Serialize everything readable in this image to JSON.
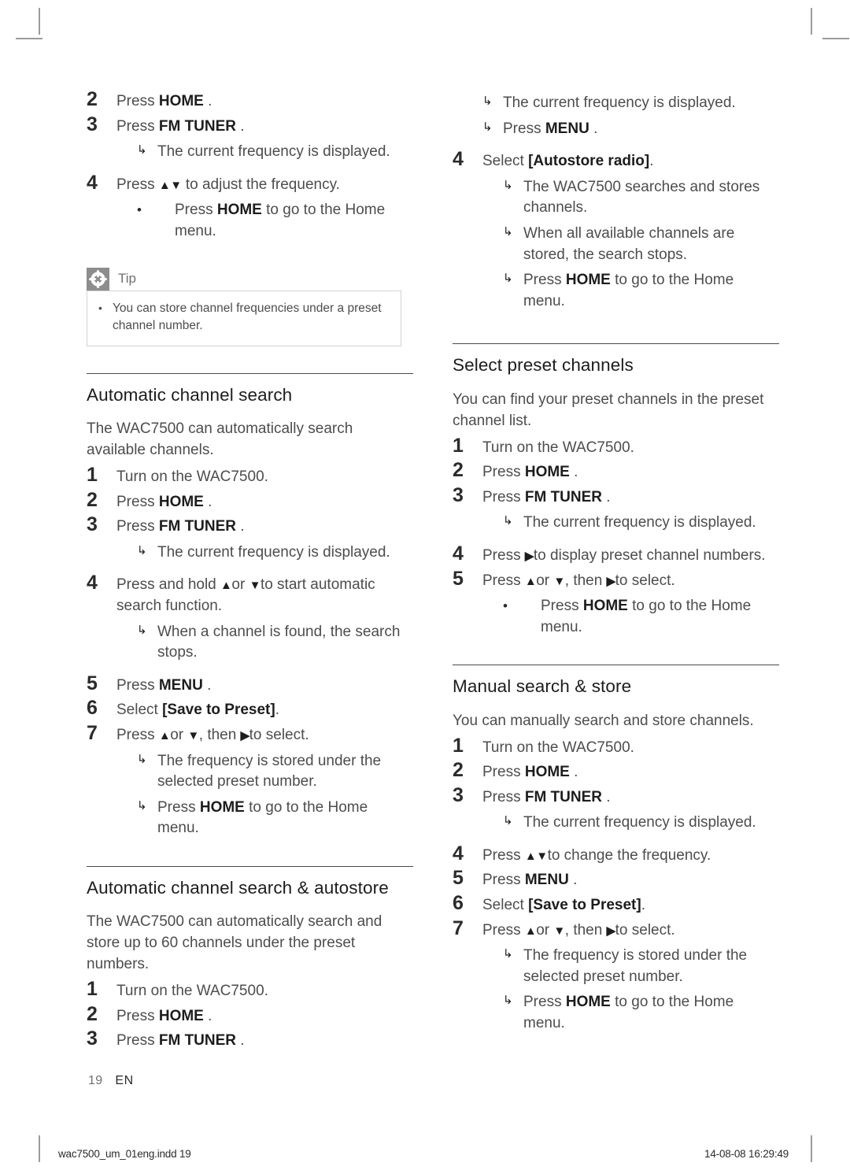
{
  "document": {
    "page_number": "19",
    "language_code": "EN",
    "print_footer_file": "wac7500_um_01eng.indd   19",
    "print_footer_date": "14-08-08   16:29:49"
  },
  "left_column": {
    "continued_steps": [
      {
        "num": "2",
        "text_pre": "Press ",
        "kw": "HOME",
        "text_post": " ."
      },
      {
        "num": "3",
        "text_pre": "Press ",
        "kw": "FM TUNER",
        "text_post": " .",
        "subs": [
          {
            "mark": "↳",
            "text": "The current frequency is displayed."
          }
        ]
      },
      {
        "num": "4",
        "text_pre": "Press ",
        "kw": "",
        "arrows": "▲▼",
        "text_post": " to adjust the frequency.",
        "bullets": [
          {
            "mark": "•",
            "pre": "Press ",
            "kw": "HOME",
            "post": " to go to the Home menu."
          }
        ]
      }
    ],
    "tip": {
      "icon": "asterisk-icon",
      "label": "Tip",
      "items": [
        "You can store channel frequencies under a preset channel number."
      ]
    },
    "sections": [
      {
        "heading": "Automatic channel search",
        "intro": "The WAC7500 can automatically search available channels.",
        "steps": [
          {
            "num": "1",
            "text": "Turn on the WAC7500."
          },
          {
            "num": "2",
            "pre": "Press ",
            "kw": "HOME",
            "post": " ."
          },
          {
            "num": "3",
            "pre": "Press ",
            "kw": "FM TUNER",
            "post": " .",
            "subs": [
              {
                "mark": "↳",
                "text": "The current frequency is displayed."
              }
            ]
          },
          {
            "num": "4",
            "pre": "Press and hold ",
            "arrows_a": "▲",
            "mid": "or ",
            "arrows_b": "▼",
            "post": "to start automatic search function.",
            "subs": [
              {
                "mark": "↳",
                "text": "When a channel is found, the search stops."
              }
            ]
          },
          {
            "num": "5",
            "pre": "Press ",
            "kw": "MENU",
            "post": " ."
          },
          {
            "num": "6",
            "pre": "Select ",
            "kw": "[Save to Preset]",
            "post": "."
          },
          {
            "num": "7",
            "pre": "Press ",
            "arrows_a": "▲",
            "mid": "or ",
            "arrows_b": "▼",
            "mid2": ", then ",
            "arrows_c": "▶",
            "post": "to select.",
            "subs": [
              {
                "mark": "↳",
                "text": "The frequency is stored under the selected preset number."
              },
              {
                "mark": "↳",
                "pre": "Press ",
                "kw": "HOME",
                "post": " to go to the Home menu."
              }
            ]
          }
        ]
      },
      {
        "heading": "Automatic channel search & autostore",
        "intro": "The WAC7500 can automatically search and store up to 60 channels under the preset numbers.",
        "steps": [
          {
            "num": "1",
            "text": "Turn on the WAC7500."
          },
          {
            "num": "2",
            "pre": "Press ",
            "kw": "HOME",
            "post": " ."
          },
          {
            "num": "3",
            "pre": "Press ",
            "kw": "FM TUNER",
            "post": " ."
          }
        ]
      }
    ]
  },
  "right_column": {
    "continued_subs": [
      {
        "mark": "↳",
        "text": "The current frequency is displayed."
      },
      {
        "mark": "↳",
        "pre": "Press ",
        "kw": "MENU",
        "post": " ."
      }
    ],
    "continued_steps": [
      {
        "num": "4",
        "pre": "Select ",
        "kw": "[Autostore radio]",
        "post": ".",
        "subs": [
          {
            "mark": "↳",
            "text": "The WAC7500 searches and stores channels."
          },
          {
            "mark": "↳",
            "text": "When all available channels are stored, the search stops."
          },
          {
            "mark": "↳",
            "pre": "Press ",
            "kw": "HOME",
            "post": " to go to the Home menu."
          }
        ]
      }
    ],
    "sections": [
      {
        "heading": "Select preset channels",
        "intro": "You can find your preset channels in the preset channel list.",
        "steps": [
          {
            "num": "1",
            "text": "Turn on the WAC7500."
          },
          {
            "num": "2",
            "pre": "Press ",
            "kw": "HOME",
            "post": " ."
          },
          {
            "num": "3",
            "pre": "Press ",
            "kw": "FM TUNER",
            "post": " .",
            "subs": [
              {
                "mark": "↳",
                "text": "The current frequency is displayed."
              }
            ]
          },
          {
            "num": "4",
            "pre": "Press ",
            "arrows_c": "▶",
            "post": "to display preset channel numbers."
          },
          {
            "num": "5",
            "pre": "Press ",
            "arrows_a": "▲",
            "mid": "or ",
            "arrows_b": "▼",
            "mid2": ", then ",
            "arrows_c": "▶",
            "post": "to select.",
            "bullets": [
              {
                "mark": "•",
                "pre": "Press ",
                "kw": "HOME",
                "post": " to go to the Home menu."
              }
            ]
          }
        ]
      },
      {
        "heading": "Manual search & store",
        "intro": "You can manually search and store channels.",
        "steps": [
          {
            "num": "1",
            "text": "Turn on the WAC7500."
          },
          {
            "num": "2",
            "pre": "Press ",
            "kw": "HOME",
            "post": " ."
          },
          {
            "num": "3",
            "pre": "Press ",
            "kw": "FM TUNER",
            "post": " .",
            "subs": [
              {
                "mark": "↳",
                "text": "The current frequency is displayed."
              }
            ]
          },
          {
            "num": "4",
            "pre": "Press ",
            "arrows": "▲▼",
            "post": "to change the frequency."
          },
          {
            "num": "5",
            "pre": "Press ",
            "kw": "MENU",
            "post": " ."
          },
          {
            "num": "6",
            "pre": "Select ",
            "kw": "[Save to Preset]",
            "post": "."
          },
          {
            "num": "7",
            "pre": "Press ",
            "arrows_a": "▲",
            "mid": "or ",
            "arrows_b": "▼",
            "mid2": ", then ",
            "arrows_c": "▶",
            "post": "to select.",
            "subs": [
              {
                "mark": "↳",
                "text": "The frequency is stored under the selected preset number."
              },
              {
                "mark": "↳",
                "pre": "Press ",
                "kw": "HOME",
                "post": " to go to the Home menu."
              }
            ]
          }
        ]
      }
    ]
  }
}
